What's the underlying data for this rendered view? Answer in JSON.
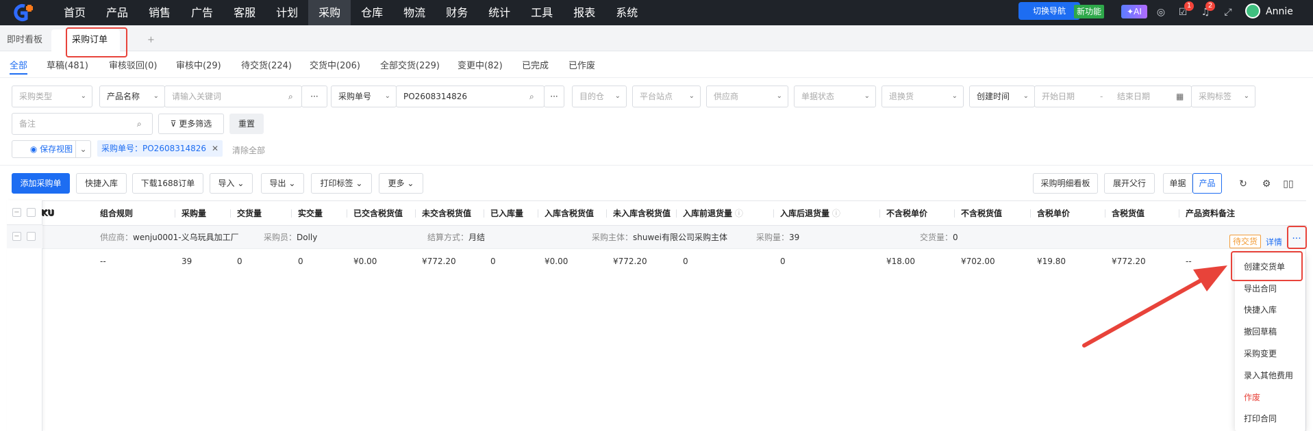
{
  "topnav": {
    "items": [
      "首页",
      "产品",
      "销售",
      "广告",
      "客服",
      "计划",
      "采购",
      "仓库",
      "物流",
      "财务",
      "统计",
      "工具",
      "报表",
      "系统"
    ],
    "active_index": 6,
    "switch_nav": "切换导航",
    "new_feature": "新功能",
    "ai": "AI",
    "task_count": "1",
    "notify_count": "2",
    "user": "Annie"
  },
  "tabs": {
    "dashboard": "即时看板",
    "current": "采购订单",
    "add": "+"
  },
  "status_tabs": [
    {
      "label": "全部"
    },
    {
      "label": "草稿(481)"
    },
    {
      "label": "审核驳回(0)"
    },
    {
      "label": "审核中(29)"
    },
    {
      "label": "待交货(224)"
    },
    {
      "label": "交货中(206)"
    },
    {
      "label": "全部交货(229)"
    },
    {
      "label": "变更中(82)"
    },
    {
      "label": "已完成"
    },
    {
      "label": "已作废"
    }
  ],
  "filters": {
    "purchase_type": "采购类型",
    "product_name": "产品名称",
    "keyword_placeholder": "请输入关键词",
    "po_field": "采购单号",
    "po_value": "PO2608314826",
    "warehouse": "目的仓",
    "site": "平台站点",
    "supplier": "供应商",
    "doc_status": "单据状态",
    "return": "退换货",
    "created_time": "创建时间",
    "start_date": "开始日期",
    "dash": "-",
    "end_date": "结束日期",
    "tag": "采购标签",
    "remark": "备注",
    "more_filter": "更多筛选",
    "reset": "重置",
    "save_view": "保存视图",
    "chip_label": "采购单号：PO2608314826",
    "clear_all": "清除全部"
  },
  "toolbar": {
    "add_po": "添加采购单",
    "quick_in": "快捷入库",
    "download_1688": "下载1688订单",
    "import": "导入",
    "export": "导出",
    "print_label": "打印标签",
    "more": "更多",
    "detail_board": "采购明细看板",
    "expand_parent": "展开父行",
    "by_doc": "单据",
    "by_product": "产品"
  },
  "table": {
    "headers": [
      "KU",
      "组合规则",
      "采购量",
      "交货量",
      "实交量",
      "已交含税货值",
      "未交含税货值",
      "已入库量",
      "入库含税货值",
      "未入库含税货值",
      "入库前退货量",
      "入库后退货量",
      "不含税单价",
      "不含税货值",
      "含税单价",
      "含税货值",
      "产品资料备注"
    ],
    "group": {
      "supplier_label": "供应商：",
      "supplier": "wenju0001-义乌玩具加工厂",
      "buyer_label": "采购员：",
      "buyer": "Dolly",
      "settle_label": "结算方式：",
      "settle": "月结",
      "entity_label": "采购主体：",
      "entity": "shuwei有限公司采购主体",
      "qty_label": "采购量：",
      "qty": "39",
      "delivered_label": "交货量：",
      "delivered": "0",
      "status": "待交货",
      "detail": "详情",
      "more": "···"
    },
    "row": [
      "--",
      "39",
      "0",
      "0",
      "¥0.00",
      "¥772.20",
      "0",
      "¥0.00",
      "¥772.20",
      "0",
      "0",
      "¥18.00",
      "¥702.00",
      "¥19.80",
      "¥772.20",
      "--"
    ]
  },
  "menu": [
    "创建交货单",
    "导出合同",
    "快捷入库",
    "撤回草稿",
    "采购变更",
    "录入其他费用",
    "作废",
    "打印合同"
  ]
}
